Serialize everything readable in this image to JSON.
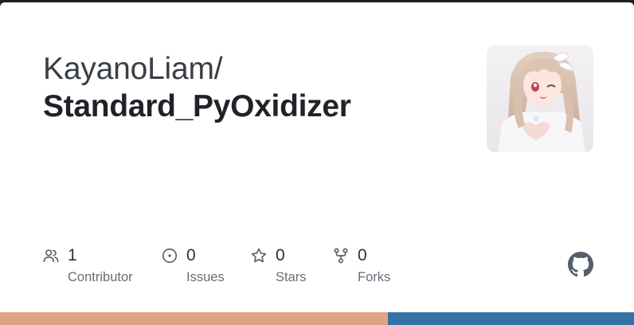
{
  "repo": {
    "owner": "KayanoLiam/",
    "name": "Standard_PyOxidizer"
  },
  "avatar": {
    "icon": "user-avatar-anime-illustration"
  },
  "stats": [
    {
      "icon": "people-icon",
      "count": "1",
      "label": "Contributor"
    },
    {
      "icon": "issue-opened-icon",
      "count": "0",
      "label": "Issues"
    },
    {
      "icon": "star-icon",
      "count": "0",
      "label": "Stars"
    },
    {
      "icon": "repo-forked-icon",
      "count": "0",
      "label": "Forks"
    }
  ],
  "brand": {
    "icon": "github-mark-icon",
    "color": "#57606a"
  },
  "languages": [
    {
      "color": "#dea584",
      "share": 0.612
    },
    {
      "color": "#3572a5",
      "share": 0.388
    }
  ]
}
